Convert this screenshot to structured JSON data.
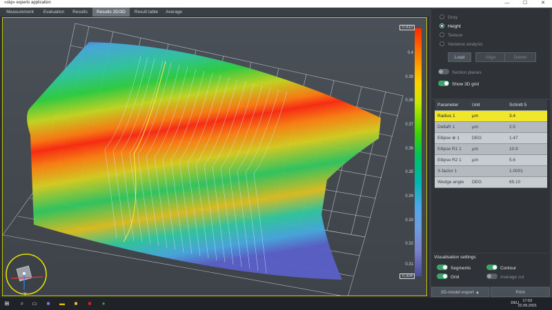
{
  "window": {
    "title": "«skp» experts application",
    "min": "—",
    "max": "☐",
    "close": "✕"
  },
  "tabs": [
    "Measurement",
    "Evaluation",
    "Results",
    "Results 2D/3D",
    "Result table",
    "Average"
  ],
  "active_tab": "Results 2D/3D",
  "colorbar": {
    "ticks": [
      "0.410",
      "0.4",
      "0.39",
      "0.38",
      "0.37",
      "0.36",
      "0.35",
      "0.34",
      "0.33",
      "0.32",
      "0.31",
      "0.304"
    ]
  },
  "view_modes": {
    "options": [
      "Grey",
      "Height",
      "Texture",
      "Variance analysis"
    ],
    "selected": "Height"
  },
  "buttons": {
    "load": "Load",
    "align": "Align",
    "delete": "Delete"
  },
  "toggles": {
    "section_planes": "Section planes",
    "show_3d_grid": "Show 3D grid"
  },
  "param_table": {
    "headers": [
      "Parameter",
      "Unit",
      "Schnitt 5"
    ],
    "rows": [
      {
        "param": "Radius 1",
        "unit": "µm",
        "value": "3.4"
      },
      {
        "param": "DeltaR 1",
        "unit": "µm",
        "value": "2.5"
      },
      {
        "param": "Ellipse ⊕ 1",
        "unit": "DEG",
        "value": "1.47"
      },
      {
        "param": "Ellipse R1 1",
        "unit": "µm",
        "value": "10.9"
      },
      {
        "param": "Ellipse R2 1",
        "unit": "µm",
        "value": "5.6"
      },
      {
        "param": "X-factor 1",
        "unit": "",
        "value": "1.0001"
      },
      {
        "param": "Wedge angle",
        "unit": "DEG",
        "value": "65.10"
      }
    ],
    "selected_row": 0
  },
  "visualisation": {
    "title": "Visualisation settings",
    "segments": "Segments",
    "contour": "Contour",
    "grid": "Grid",
    "average_cut": "Average cut"
  },
  "bottom": {
    "export": "3D-model export",
    "print": "Print"
  },
  "axes": {
    "y": "Y"
  },
  "taskbar": {
    "lang": "DEU",
    "time": "17:03",
    "date": "22.09.2021"
  },
  "colors": {
    "accent": "#f0e62a",
    "toggle_on": "#3ea36a",
    "frame": "#c8c800"
  }
}
